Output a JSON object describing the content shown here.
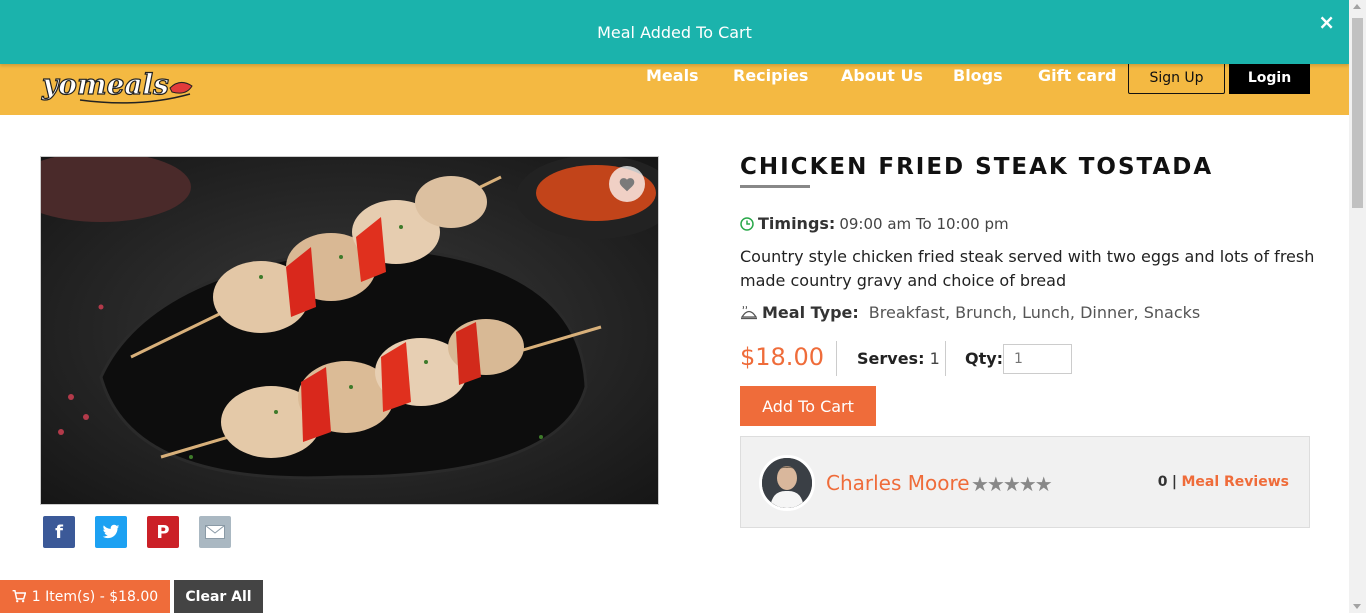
{
  "notification": {
    "message": "Meal Added To Cart",
    "close_label": "×"
  },
  "brand": {
    "logo_text": "yomeals"
  },
  "nav": {
    "items": [
      "Meals",
      "Recipies",
      "About Us",
      "Blogs",
      "Gift card"
    ],
    "signup_label": "Sign Up",
    "login_label": "Login"
  },
  "meal": {
    "title": "CHICKEN FRIED STEAK TOSTADA",
    "timings_label": "Timings:",
    "timings_value": "09:00 am To 10:00 pm",
    "description": "Country style chicken fried steak served with two eggs and lots of fresh made country gravy and choice of bread",
    "meal_type_label": "Meal Type:",
    "meal_type_value": "Breakfast, Brunch, Lunch, Dinner, Snacks",
    "price": "$18.00",
    "serves_label": "Serves:",
    "serves_value": "1",
    "qty_label": "Qty:",
    "qty_placeholder": "1",
    "add_to_cart_label": "Add To Cart"
  },
  "chef": {
    "name": "Charles Moore",
    "rating_stars": "★★★★★",
    "review_count": "0",
    "separator": "|",
    "reviews_label": "Meal Reviews"
  },
  "social": {
    "facebook": "f",
    "twitter": "twitter-icon",
    "pinterest": "P",
    "email": "email-icon"
  },
  "cart_bar": {
    "summary": "1 Item(s) - $18.00",
    "clear_label": "Clear All"
  },
  "colors": {
    "header": "#f4b942",
    "notification": "#1bb3ac",
    "accent": "#ef6c3a",
    "facebook": "#3b5998",
    "twitter": "#1da1f2",
    "pinterest": "#cb2027",
    "email": "#aab8c2"
  }
}
